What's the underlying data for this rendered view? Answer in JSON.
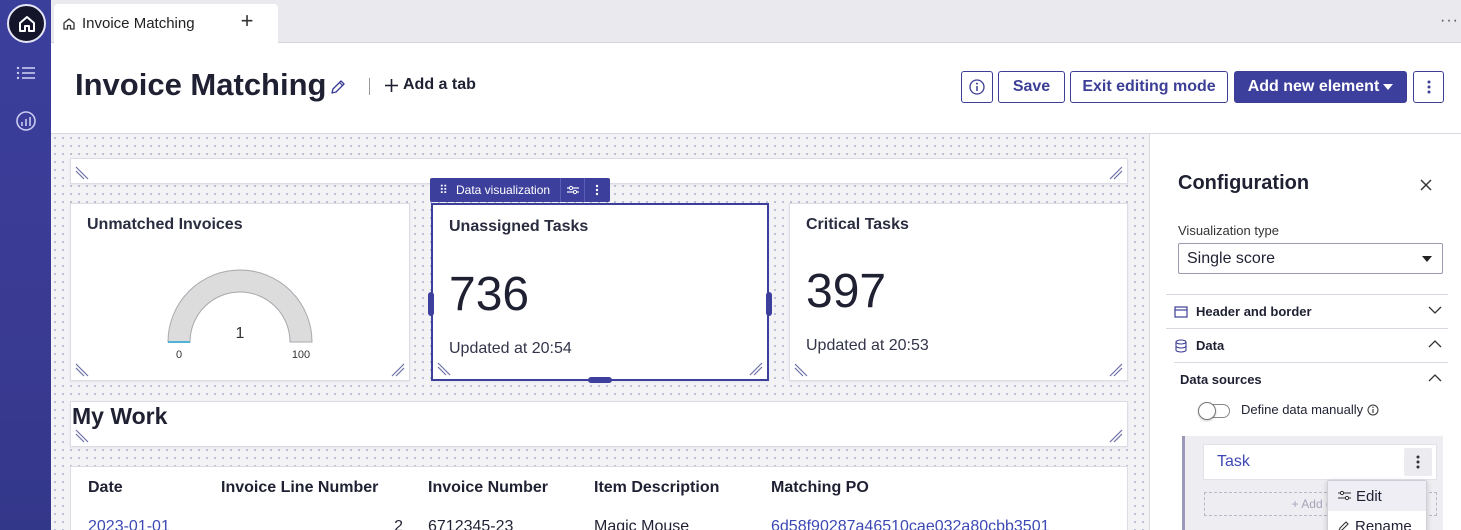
{
  "tabs": [
    {
      "label": "Invoice Matching"
    }
  ],
  "header": {
    "title": "Invoice Matching",
    "add_tab_label": "Add a tab",
    "save_label": "Save",
    "exit_label": "Exit editing mode",
    "add_element_label": "Add new element"
  },
  "toolbar": {
    "label": "Data visualization"
  },
  "cards": {
    "unmatched": {
      "title": "Unmatched Invoices",
      "gauge_value": "1",
      "gauge_min": "0",
      "gauge_max": "100"
    },
    "unassigned": {
      "title": "Unassigned Tasks",
      "score": "736",
      "updated": "Updated at 20:54"
    },
    "critical": {
      "title": "Critical Tasks",
      "score": "397",
      "updated": "Updated at 20:53"
    }
  },
  "mywork": {
    "title": "My Work"
  },
  "table": {
    "columns": [
      "Date",
      "Invoice Line Number",
      "Invoice Number",
      "Item Description",
      "Matching PO"
    ],
    "rows": [
      [
        "2023-01-01",
        "2",
        "6712345-23",
        "Magic Mouse",
        "6d58f90287a46510cae032a80cbb3501"
      ]
    ]
  },
  "config": {
    "title": "Configuration",
    "viz_type_label": "Visualization type",
    "viz_type_value": "Single score",
    "sections": {
      "header_border": "Header and border",
      "data": "Data",
      "data_sources": "Data sources"
    },
    "define_manually": "Define data manually",
    "source_name": "Task",
    "add_data": "+ Add data",
    "menu": {
      "edit": "Edit",
      "rename": "Rename"
    }
  },
  "colors": {
    "brand": "#3d3f9c",
    "link": "#3d48b5"
  }
}
